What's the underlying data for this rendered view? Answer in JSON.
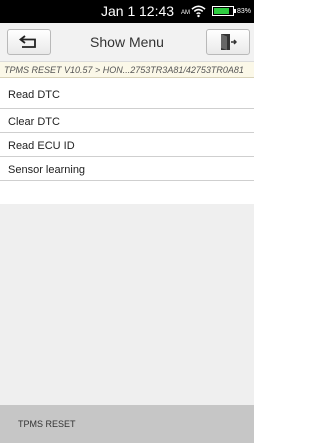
{
  "status_bar": {
    "date": "Jan 1",
    "time": "12:43",
    "ampm": "AM",
    "battery_percent": "83%",
    "battery_level": 0.83,
    "wifi_icon": "wifi-icon",
    "battery_icon": "battery-icon",
    "battery_color": "#2ecc40"
  },
  "toolbar": {
    "title": "Show Menu",
    "back_icon": "back-arrow-icon",
    "exit_icon": "exit-door-icon"
  },
  "breadcrumb": {
    "path": "TPMS RESET V10.57 > HON...2753TR3A81/42753TR0A81"
  },
  "menu": {
    "items": [
      {
        "label": "Read DTC"
      },
      {
        "label": "Clear DTC"
      },
      {
        "label": "Read ECU ID"
      },
      {
        "label": "Sensor learning"
      }
    ]
  },
  "footer": {
    "label": "TPMS RESET"
  }
}
